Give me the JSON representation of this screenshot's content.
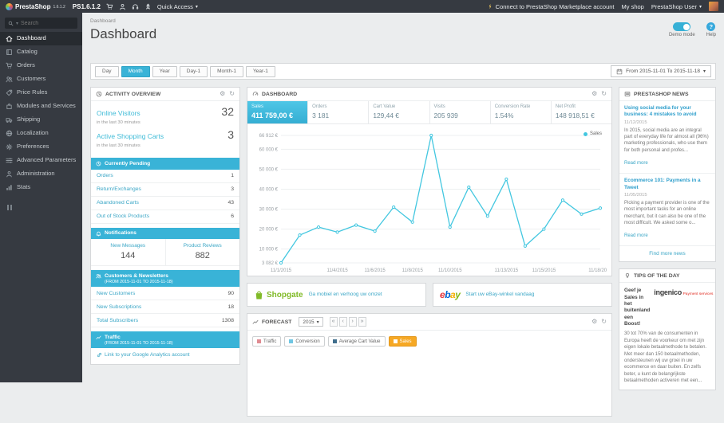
{
  "topbar": {
    "brand": "PrestaShop",
    "version": "1.6.1.2",
    "shop_name": "PS1.6.1.2",
    "quick_access": "Quick Access",
    "marketplace_link": "Connect to PrestaShop Marketplace account",
    "my_shop": "My shop",
    "user": "PrestaShop User"
  },
  "sidebar": {
    "search_placeholder": "Search",
    "items": [
      {
        "label": "Dashboard",
        "icon": "home-icon",
        "active": true
      },
      {
        "label": "Catalog",
        "icon": "book-icon",
        "active": false
      },
      {
        "label": "Orders",
        "icon": "cart-icon",
        "active": false
      },
      {
        "label": "Customers",
        "icon": "customers-icon",
        "active": false
      },
      {
        "label": "Price Rules",
        "icon": "tag-icon",
        "active": false
      },
      {
        "label": "Modules and Services",
        "icon": "puzzle-icon",
        "active": false
      },
      {
        "label": "Shipping",
        "icon": "truck-icon",
        "active": false
      },
      {
        "label": "Localization",
        "icon": "globe-icon",
        "active": false
      },
      {
        "label": "Preferences",
        "icon": "gear-icon",
        "active": false
      },
      {
        "label": "Advanced Parameters",
        "icon": "sliders-icon",
        "active": false
      },
      {
        "label": "Administration",
        "icon": "person-icon",
        "active": false
      },
      {
        "label": "Stats",
        "icon": "stats-icon",
        "active": false
      }
    ]
  },
  "header": {
    "breadcrumb": "Dashboard",
    "title": "Dashboard",
    "demo_mode_label": "Demo mode",
    "help_label": "Help"
  },
  "filters": {
    "buttons": [
      "Day",
      "Month",
      "Year",
      "Day-1",
      "Month-1",
      "Year-1"
    ],
    "active": "Month",
    "date_range": "From 2015-11-01 To 2015-11-18"
  },
  "activity": {
    "title": "Activity overview",
    "online_visitors_label": "Online Visitors",
    "online_visitors_value": "32",
    "online_visitors_sub": "in the last 30 minutes",
    "active_carts_label": "Active Shopping Carts",
    "active_carts_value": "3",
    "active_carts_sub": "in the last 30 minutes",
    "pending": {
      "title": "Currently Pending",
      "rows": [
        {
          "label": "Orders",
          "value": "1"
        },
        {
          "label": "Return/Exchanges",
          "value": "3"
        },
        {
          "label": "Abandoned Carts",
          "value": "43"
        },
        {
          "label": "Out of Stock Products",
          "value": "6"
        }
      ]
    },
    "notifications": {
      "title": "Notifications",
      "columns": [
        {
          "label": "New Messages",
          "value": "144"
        },
        {
          "label": "Product Reviews",
          "value": "882"
        }
      ]
    },
    "customers": {
      "title": "Customers & Newsletters",
      "subtitle": "(FROM 2015-11-01 TO 2015-11-18)",
      "rows": [
        {
          "label": "New Customers",
          "value": "90"
        },
        {
          "label": "New Subscriptions",
          "value": "18"
        },
        {
          "label": "Total Subscribers",
          "value": "1308"
        }
      ]
    },
    "traffic": {
      "title": "Traffic",
      "subtitle": "(FROM 2015-11-01 TO 2015-11-18)",
      "link": "Link to your Google Analytics account"
    }
  },
  "dashboard_panel": {
    "title": "Dashboard",
    "kpis": [
      {
        "label": "Sales",
        "value": "411 759,00 €",
        "active": true
      },
      {
        "label": "Orders",
        "value": "3 181",
        "active": false
      },
      {
        "label": "Cart Value",
        "value": "129,44 €",
        "active": false
      },
      {
        "label": "Visits",
        "value": "205 939",
        "active": false
      },
      {
        "label": "Conversion Rate",
        "value": "1.54%",
        "active": false
      },
      {
        "label": "Net Profit",
        "value": "148 918,51 €",
        "active": false
      }
    ],
    "legend_label": "Sales"
  },
  "chart_data": {
    "type": "line",
    "title": "Sales",
    "x": [
      "11/1/2015",
      "11/2/2015",
      "11/3/2015",
      "11/4/2015",
      "11/5/2015",
      "11/6/2015",
      "11/7/2015",
      "11/8/2015",
      "11/9/2015",
      "11/10/2015",
      "11/11/2015",
      "11/12/2015",
      "11/13/2015",
      "11/14/2015",
      "11/15/2015",
      "11/16/2015",
      "11/17/2015",
      "11/18/2015"
    ],
    "x_tick_indices": [
      0,
      3,
      5,
      7,
      9,
      12,
      14,
      17
    ],
    "x_tick_labels": [
      "11/1/2015",
      "11/4/2015",
      "11/6/2015",
      "11/8/2015",
      "11/10/2015",
      "11/13/2015",
      "11/15/2015",
      "11/18/2015"
    ],
    "y_ticks": [
      3082,
      10000,
      20000,
      30000,
      40000,
      50000,
      60000,
      66912
    ],
    "y_tick_labels": [
      "3 082 €",
      "10 000 €",
      "20 000 €",
      "30 000 €",
      "40 000 €",
      "50 000 €",
      "60 000 €",
      "66 912 €"
    ],
    "ylim": [
      3082,
      66912
    ],
    "grid": true,
    "legend_position": "top-right",
    "series": [
      {
        "name": "Sales",
        "color": "#43c7e0",
        "values": [
          3082,
          17000,
          21000,
          18500,
          22000,
          19000,
          31000,
          23500,
          66912,
          21000,
          41000,
          26500,
          45000,
          11500,
          20000,
          34500,
          27500,
          30500
        ]
      }
    ]
  },
  "modules": {
    "shopgate": {
      "name": "Shopgate",
      "brand_color": "#80ba27",
      "link": "Ga mobiel en verhoog uw omzet"
    },
    "ebay": {
      "name": "ebay",
      "letters": [
        {
          "char": "e",
          "color": "#e53238"
        },
        {
          "char": "b",
          "color": "#0064d2"
        },
        {
          "char": "a",
          "color": "#f5af02"
        },
        {
          "char": "y",
          "color": "#86b817"
        }
      ],
      "link": "Start uw eBay-winkel vandaag"
    }
  },
  "forecast": {
    "title": "Forecast",
    "year": "2015",
    "nav": [
      "«",
      "‹",
      "›",
      "»"
    ],
    "legend": [
      {
        "label": "Traffic",
        "color": "#e08b92",
        "active": false
      },
      {
        "label": "Conversion",
        "color": "#6fc6e3",
        "active": false
      },
      {
        "label": "Average Cart Value",
        "color": "#3f6e8c",
        "active": false
      },
      {
        "label": "Sales",
        "color": "#f6a824",
        "active": true
      }
    ]
  },
  "news": {
    "title": "PrestaShop News",
    "articles": [
      {
        "title": "Using social media for your business: 4 mistakes to avoid",
        "date": "11/12/2015",
        "excerpt": "In 2015, social media are an integral part of everyday life for almost all (96%) marketing professionals, who use them for both personal and profes...",
        "read_more": "Read more"
      },
      {
        "title": "Ecommerce 101: Payments in a Tweet",
        "date": "11/05/2015",
        "excerpt": "Picking a payment provider is one of the most important tasks for an online merchant, but it can also be one of the most difficult. We asked some o...",
        "read_more": "Read more"
      }
    ],
    "find_more": "Find more news"
  },
  "tips": {
    "title": "Tips of the day",
    "headline": "Geef je Sales in het buitenland een Boost!",
    "brand": "ingenico",
    "brand_sub": "Payment services",
    "body": "30 tot 70% van de consumenten in Europa heeft de voorkeur om met zijn eigen lokale betaalmethode te betalen. Met meer dan 150 betaalmethoden, ondersteunen wij uw groei in uw ecommerce en daar buiten. En zelfs beter, u kunt de belangrijkste betaalmethoden activeren met een..."
  },
  "colors": {
    "accent": "#39b3d7",
    "topbar": "#363a41",
    "background": "#ebedee",
    "active_kpi": "#41bde2"
  }
}
